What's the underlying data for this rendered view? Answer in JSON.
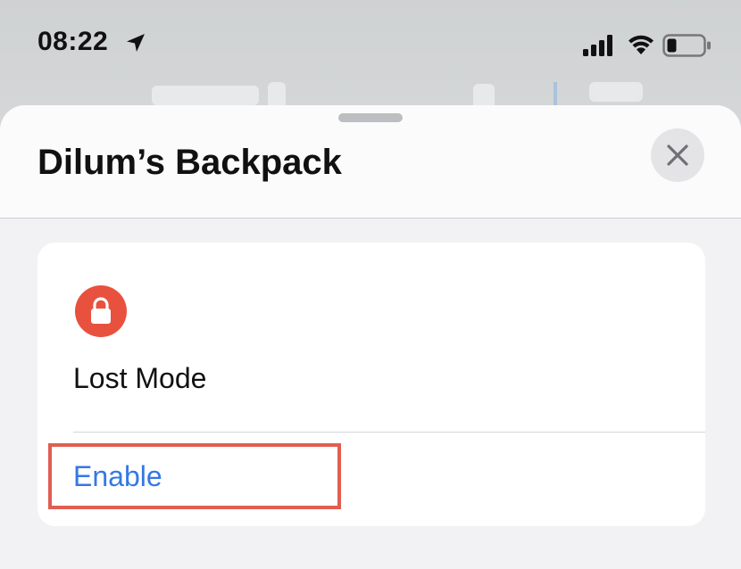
{
  "status_bar": {
    "time": "08:22",
    "location_icon": "location-arrow-icon",
    "signal_icon": "cellular-signal-icon",
    "wifi_icon": "wifi-icon",
    "battery_icon": "battery-low-icon"
  },
  "sheet": {
    "title": "Dilum’s Backpack",
    "close_icon": "close-icon"
  },
  "lost_mode_card": {
    "icon": "lock-icon",
    "icon_color": "#E9513F",
    "title": "Lost Mode",
    "action_label": "Enable",
    "action_color": "#3478E4"
  },
  "annotation": {
    "highlight_color": "#E05E52"
  }
}
